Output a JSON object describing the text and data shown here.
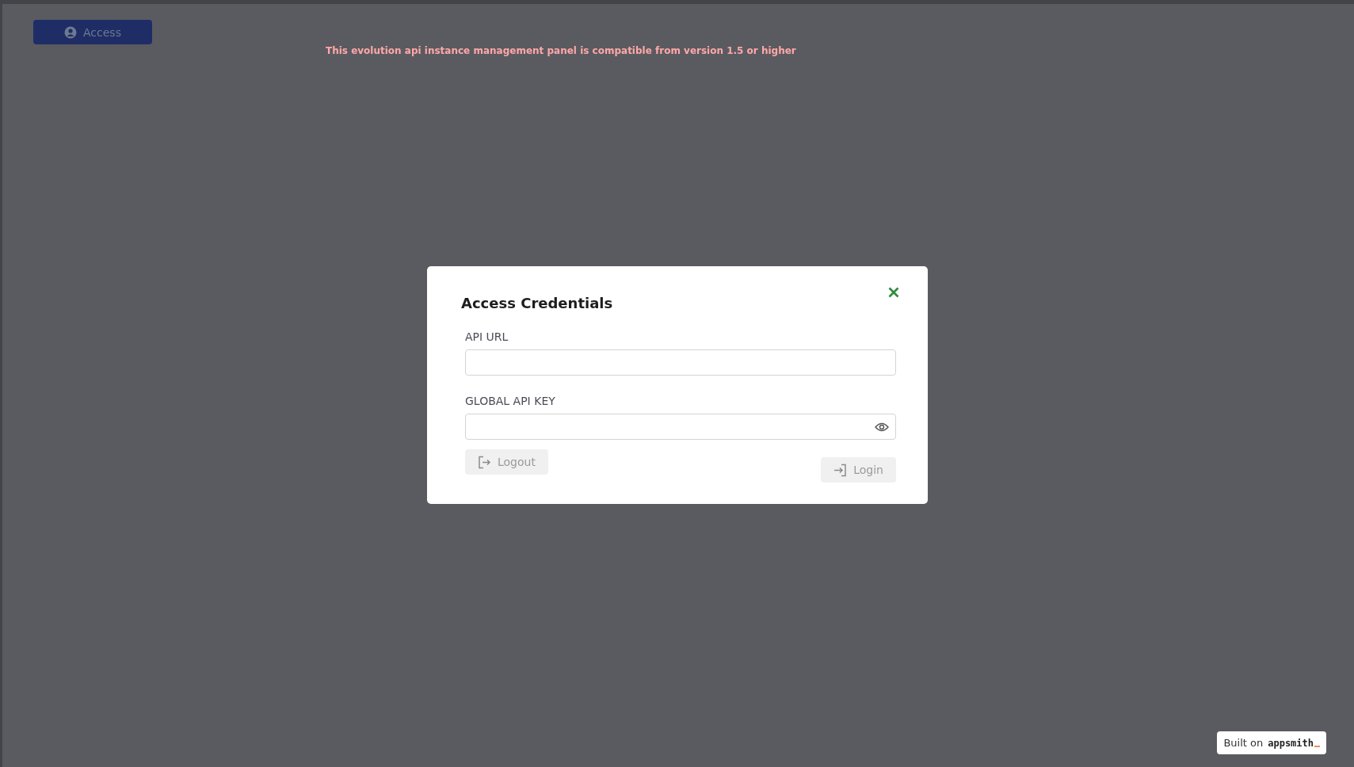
{
  "header": {
    "access_button": {
      "label": "Access"
    },
    "notice": "This evolution api instance management panel is compatible from version 1.5 or higher"
  },
  "modal": {
    "title": "Access Credentials",
    "fields": [
      {
        "kind": "text",
        "label": "API URL"
      },
      {
        "kind": "password",
        "label": "GLOBAL API KEY"
      }
    ],
    "buttons": [
      {
        "kind": "logout",
        "label": "Logout",
        "disabled": true
      },
      {
        "kind": "login",
        "label": "Login",
        "disabled": true
      }
    ]
  },
  "badge": {
    "label": "Built on",
    "logo": "appsmith"
  }
}
